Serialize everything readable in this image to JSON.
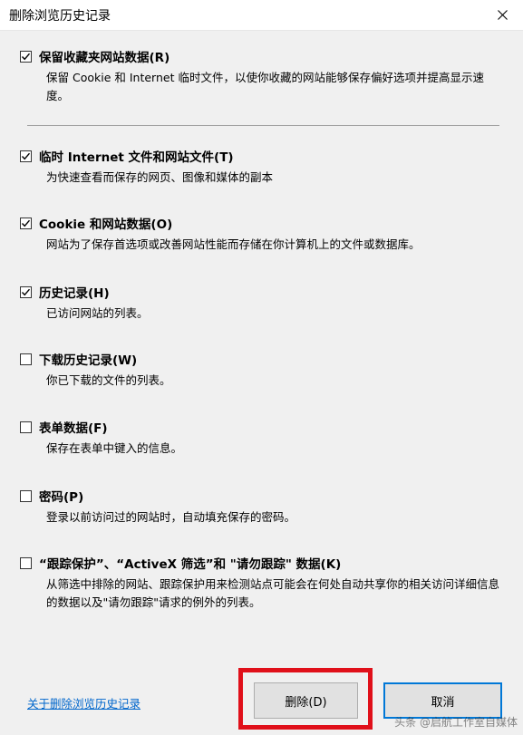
{
  "window": {
    "title": "删除浏览历史记录",
    "close_icon": "close-icon"
  },
  "options": [
    {
      "checked": true,
      "label": "保留收藏夹网站数据(R)",
      "description": "保留 Cookie 和 Internet 临时文件，以使你收藏的网站能够保存偏好选项并提高显示速度。"
    },
    {
      "checked": true,
      "label": "临时 Internet 文件和网站文件(T)",
      "description": "为快速查看而保存的网页、图像和媒体的副本"
    },
    {
      "checked": true,
      "label": "Cookie 和网站数据(O)",
      "description": "网站为了保存首选项或改善网站性能而存储在你计算机上的文件或数据库。"
    },
    {
      "checked": true,
      "label": "历史记录(H)",
      "description": "已访问网站的列表。"
    },
    {
      "checked": false,
      "label": "下载历史记录(W)",
      "description": "你已下载的文件的列表。"
    },
    {
      "checked": false,
      "label": "表单数据(F)",
      "description": "保存在表单中键入的信息。"
    },
    {
      "checked": false,
      "label": "密码(P)",
      "description": "登录以前访问过的网站时，自动填充保存的密码。"
    },
    {
      "checked": false,
      "label": "“跟踪保护”、“ActiveX 筛选”和 \"请勿跟踪\" 数据(K)",
      "description": "从筛选中排除的网站、跟踪保护用来检测站点可能会在何处自动共享你的相关访问详细信息的数据以及\"请勿跟踪\"请求的例外的列表。"
    }
  ],
  "footer": {
    "about_link": "关于删除浏览历史记录",
    "delete_button": "删除(D)",
    "cancel_button": "取消"
  },
  "watermark": "头条 @启航工作室自媒体",
  "colors": {
    "highlight": "#e0101a",
    "link": "#0066cc",
    "focus": "#0078d7"
  }
}
